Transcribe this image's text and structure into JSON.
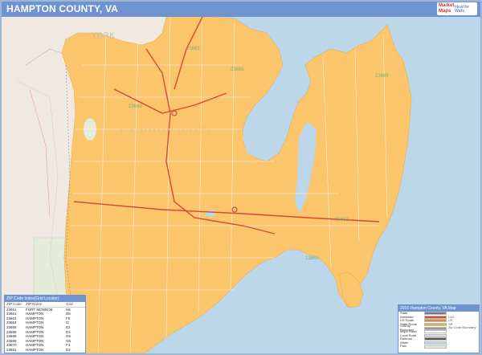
{
  "title": "HAMPTON COUNTY, VA",
  "logo": {
    "line1": "Market",
    "line2": "Maps",
    "line3": "Ideal for Walls"
  },
  "map": {
    "colors": {
      "water": "#bcd6ea",
      "county": "#fbc56b",
      "outside_land": "#efe9e1",
      "park": "#e4ecd9",
      "highway": "#d44a3a",
      "road": "#ffffff"
    },
    "place_labels": {
      "york": "YORK",
      "city": "HAMPTON (CITY)"
    },
    "zip_labels": [
      "23661",
      "23665",
      "23669",
      "23669",
      "23663",
      "23666"
    ]
  },
  "zip_table": {
    "title": "ZIP Code Index(Grid Locator)",
    "headers": [
      "ZIP Code",
      "ZIP Name",
      "Grid"
    ],
    "rows": [
      [
        "23651",
        "FORT MONROE",
        "H6"
      ],
      [
        "23661",
        "HAMPTON",
        "D6"
      ],
      [
        "23663",
        "HAMPTON",
        "F6"
      ],
      [
        "23664",
        "HAMPTON",
        "I3"
      ],
      [
        "23665",
        "HAMPTON",
        "E2"
      ],
      [
        "23666",
        "HAMPTON",
        "D4"
      ],
      [
        "23668",
        "HAMPTON",
        "G6"
      ],
      [
        "23669",
        "HAMPTON",
        "G5"
      ],
      [
        "23670",
        "HAMPTON",
        "F4"
      ],
      [
        "23681",
        "HAMPTON",
        "E3"
      ]
    ]
  },
  "legend": {
    "title": "2016 Hampton County, VA Map",
    "rows": [
      {
        "name": "State",
        "sym": "#777777",
        "value": ""
      },
      {
        "name": "Interstate",
        "sym": "#d44a3a",
        "value": "I-64"
      },
      {
        "name": "US Route",
        "sym": "#e08a3a",
        "value": "US"
      },
      {
        "name": "State Route",
        "sym": "#e0b43a",
        "value": "SR"
      },
      {
        "name": "County Boundary",
        "sym": "#999999",
        "value": "Zip Code Boundary"
      },
      {
        "name": "Major Road",
        "sym": "#ffffff",
        "value": ""
      },
      {
        "name": "Local Road",
        "sym": "#dddddd",
        "value": ""
      },
      {
        "name": "Railroad",
        "sym": "#555555",
        "value": ""
      },
      {
        "name": "Water",
        "sym": "#bcd6ea",
        "value": ""
      },
      {
        "name": "Park",
        "sym": "#e4ecd9",
        "value": ""
      }
    ]
  }
}
